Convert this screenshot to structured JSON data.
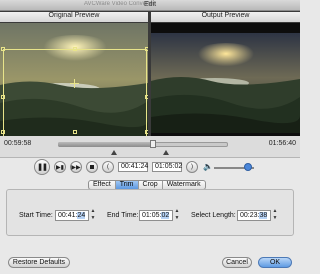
{
  "window": {
    "title": "Edit",
    "background_title": "AVCWare Video Converter"
  },
  "preview": {
    "original_label": "Original Preview",
    "output_label": "Output Preview"
  },
  "timeline": {
    "start_time": "00:59:58",
    "end_time": "01:56:40",
    "position_fraction": 0.56
  },
  "playback": {
    "current_time": "00:41:24",
    "end_time": "01:05:02",
    "volume_fraction": 0.85,
    "buttons": {
      "pause_icon": "pause-icon",
      "next_frame_icon": "next-frame-icon",
      "forward_icon": "forward-icon",
      "stop_icon": "stop-icon",
      "mark_in_icon": "mark-in-bracket-icon",
      "mark_out_icon": "mark-out-bracket-icon",
      "volume_icon": "speaker-icon"
    },
    "mark_in_glyph": "(",
    "mark_out_glyph": ")"
  },
  "tabs": [
    {
      "label": "Effect",
      "active": false
    },
    {
      "label": "Trim",
      "active": true
    },
    {
      "label": "Crop",
      "active": false
    },
    {
      "label": "Watermark",
      "active": false
    }
  ],
  "trim": {
    "start_label": "Start Time:",
    "start_value_prefix": "00:41:",
    "start_value_selected": "24",
    "end_label": "End Time:",
    "end_value_prefix": "01:05:",
    "end_value_selected": "02",
    "length_label": "Select Length:",
    "length_value_prefix": "00:23:",
    "length_value_selected": "38"
  },
  "footer": {
    "restore_label": "Restore Defaults",
    "cancel_label": "Cancel",
    "ok_label": "OK"
  },
  "colors": {
    "accent": "#5f9be3",
    "crop_outline": "#e8e48a"
  }
}
